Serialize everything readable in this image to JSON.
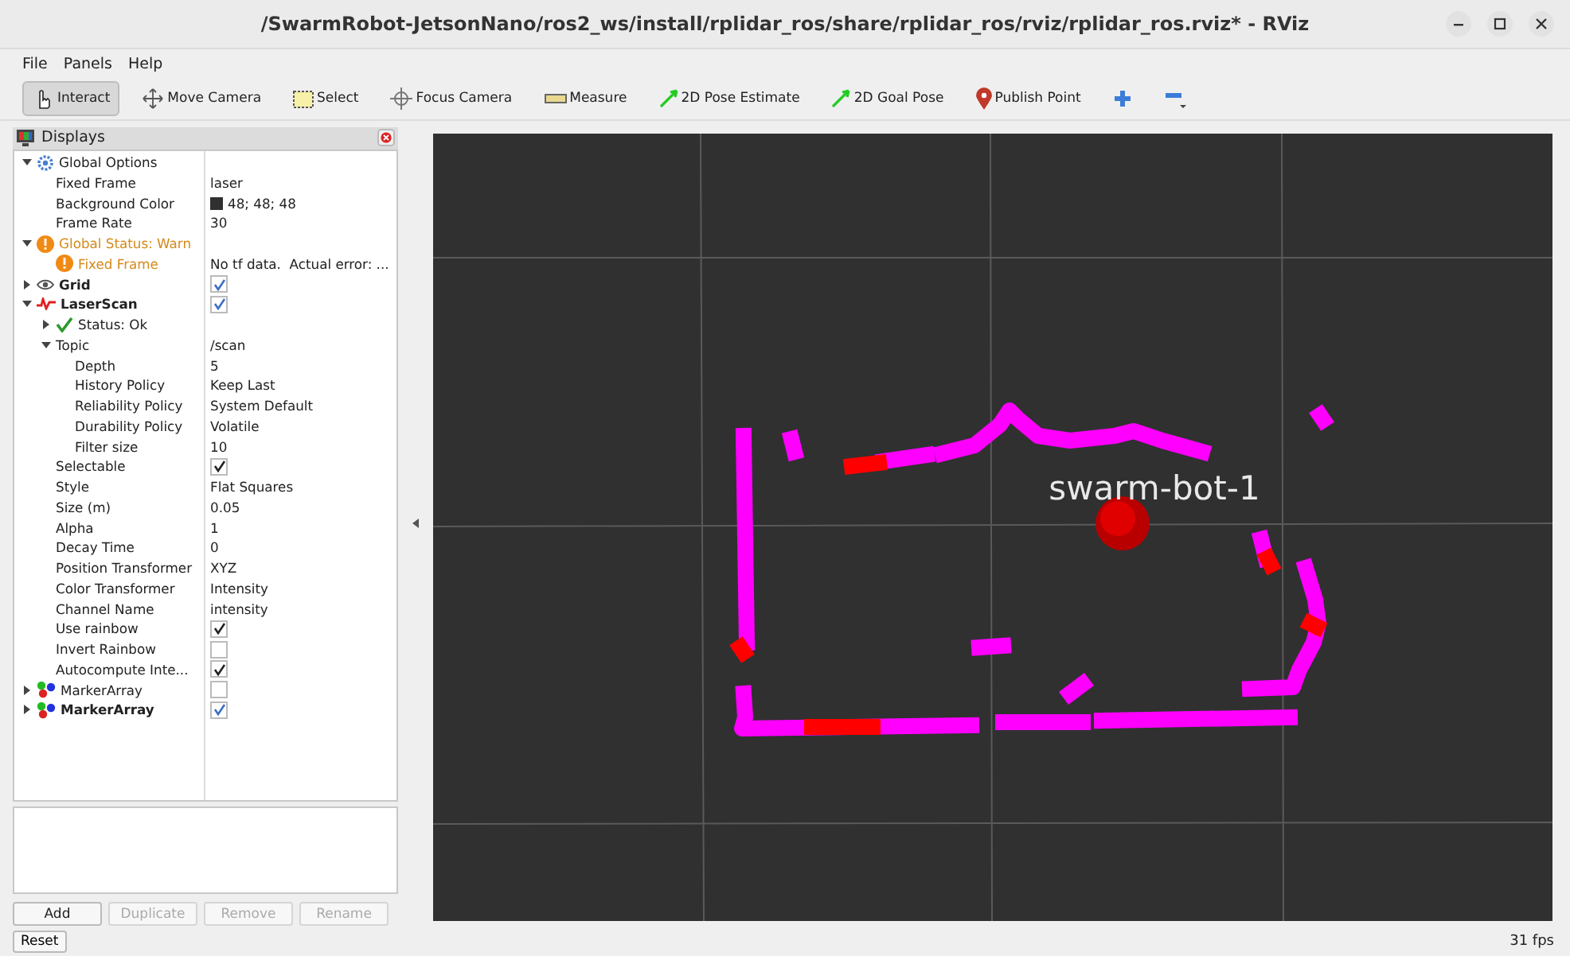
{
  "window": {
    "title": "/SwarmRobot-JetsonNano/ros2_ws/install/rplidar_ros/share/rplidar_ros/rviz/rplidar_ros.rviz* - RViz"
  },
  "menu": [
    "File",
    "Panels",
    "Help"
  ],
  "tools": [
    {
      "label": "Interact",
      "kind": "interact",
      "selected": true
    },
    {
      "label": "Move Camera",
      "kind": "move",
      "selected": false
    },
    {
      "label": "Select",
      "kind": "select",
      "selected": false
    },
    {
      "label": "Focus Camera",
      "kind": "focus",
      "selected": false
    },
    {
      "label": "Measure",
      "kind": "measure",
      "selected": false
    },
    {
      "label": "2D Pose Estimate",
      "kind": "pose",
      "selected": false
    },
    {
      "label": "2D Goal Pose",
      "kind": "pose",
      "selected": false
    },
    {
      "label": "Publish Point",
      "kind": "point",
      "selected": false
    },
    {
      "kind": "add",
      "selected": false
    },
    {
      "kind": "remove",
      "selected": false
    }
  ],
  "displays": {
    "title": "Displays",
    "items": [
      {
        "label": "Global Options",
        "kind": "options",
        "expanded": true,
        "children": [
          {
            "label": "Fixed Frame",
            "kind": "property",
            "value": "laser"
          },
          {
            "label": "Background Color",
            "kind": "property",
            "value": "48; 48; 48",
            "color": "#303030"
          },
          {
            "label": "Frame Rate",
            "kind": "property",
            "value": "30"
          }
        ]
      },
      {
        "label": "Global Status: Warn",
        "kind": "warning",
        "expanded": true,
        "children": [
          {
            "label": "Fixed Frame",
            "kind": "warning",
            "value": "No tf data.  Actual error: ..."
          }
        ]
      },
      {
        "label": "Grid",
        "kind": "grid",
        "expanded": false,
        "checked": true
      },
      {
        "label": "LaserScan",
        "kind": "laserscan",
        "expanded": true,
        "checked": true,
        "children": [
          {
            "label": "Status: Ok",
            "kind": "ok",
            "expanded": false
          },
          {
            "label": "Topic",
            "kind": "property",
            "value": "/scan",
            "expanded": true,
            "children": [
              {
                "label": "Depth",
                "kind": "property",
                "value": "5"
              },
              {
                "label": "History Policy",
                "kind": "property",
                "value": "Keep Last"
              },
              {
                "label": "Reliability Policy",
                "kind": "property",
                "value": "System Default"
              },
              {
                "label": "Durability Policy",
                "kind": "property",
                "value": "Volatile"
              },
              {
                "label": "Filter size",
                "kind": "property",
                "value": "10"
              }
            ]
          },
          {
            "label": "Selectable",
            "kind": "property",
            "checked": true
          },
          {
            "label": "Style",
            "kind": "property",
            "value": "Flat Squares"
          },
          {
            "label": "Size (m)",
            "kind": "property",
            "value": "0.05"
          },
          {
            "label": "Alpha",
            "kind": "property",
            "value": "1"
          },
          {
            "label": "Decay Time",
            "kind": "property",
            "value": "0"
          },
          {
            "label": "Position Transformer",
            "kind": "property",
            "value": "XYZ"
          },
          {
            "label": "Color Transformer",
            "kind": "property",
            "value": "Intensity"
          },
          {
            "label": "Channel Name",
            "kind": "property",
            "value": "intensity"
          },
          {
            "label": "Use rainbow",
            "kind": "property",
            "checked": true
          },
          {
            "label": "Invert Rainbow",
            "kind": "property",
            "checked": false
          },
          {
            "label": "Autocompute Inte...",
            "kind": "property",
            "checked": true
          }
        ]
      },
      {
        "label": "MarkerArray",
        "kind": "markers",
        "expanded": false,
        "checked": false
      },
      {
        "label": "MarkerArray",
        "kind": "markers",
        "expanded": false,
        "checked": true
      }
    ]
  },
  "buttons": [
    {
      "label": "Add",
      "disabled": false
    },
    {
      "label": "Duplicate",
      "disabled": true
    },
    {
      "label": "Remove",
      "disabled": true
    },
    {
      "label": "Rename",
      "disabled": true
    }
  ],
  "viewport": {
    "marker_label": "swarm-bot-1"
  },
  "status_bar": {
    "reset": "Reset",
    "fps": "31 fps"
  }
}
